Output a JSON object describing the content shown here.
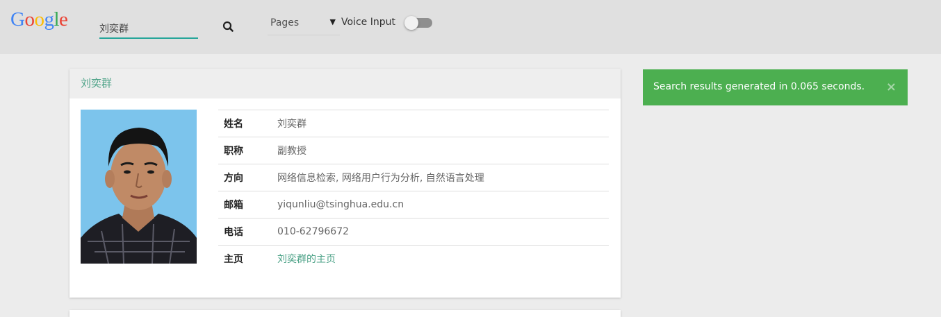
{
  "header": {
    "logo": [
      {
        "ch": "G",
        "color": "#4285f4"
      },
      {
        "ch": "o",
        "color": "#ea4335"
      },
      {
        "ch": "o",
        "color": "#fbbc05"
      },
      {
        "ch": "g",
        "color": "#4285f4"
      },
      {
        "ch": "l",
        "color": "#34a853"
      },
      {
        "ch": "e",
        "color": "#ea4335"
      }
    ],
    "search_value": "刘奕群",
    "search_icon": "search-icon",
    "select_value": "Pages",
    "voice_label": "Voice Input",
    "voice_toggle_on": false
  },
  "result": {
    "title": "刘奕群",
    "rows": [
      {
        "label": "姓名",
        "value": "刘奕群"
      },
      {
        "label": "职称",
        "value": "副教授"
      },
      {
        "label": "方向",
        "value": "网络信息检索, 网络用户行为分析, 自然语言处理"
      },
      {
        "label": "邮箱",
        "value": "yiqunliu@tsinghua.edu.cn"
      },
      {
        "label": "电话",
        "value": "010-62796672"
      },
      {
        "label": "主页",
        "value": "刘奕群的主页"
      }
    ]
  },
  "toast": {
    "message": "Search results generated in 0.065 seconds.",
    "close": "×",
    "color": "#4caf50"
  }
}
